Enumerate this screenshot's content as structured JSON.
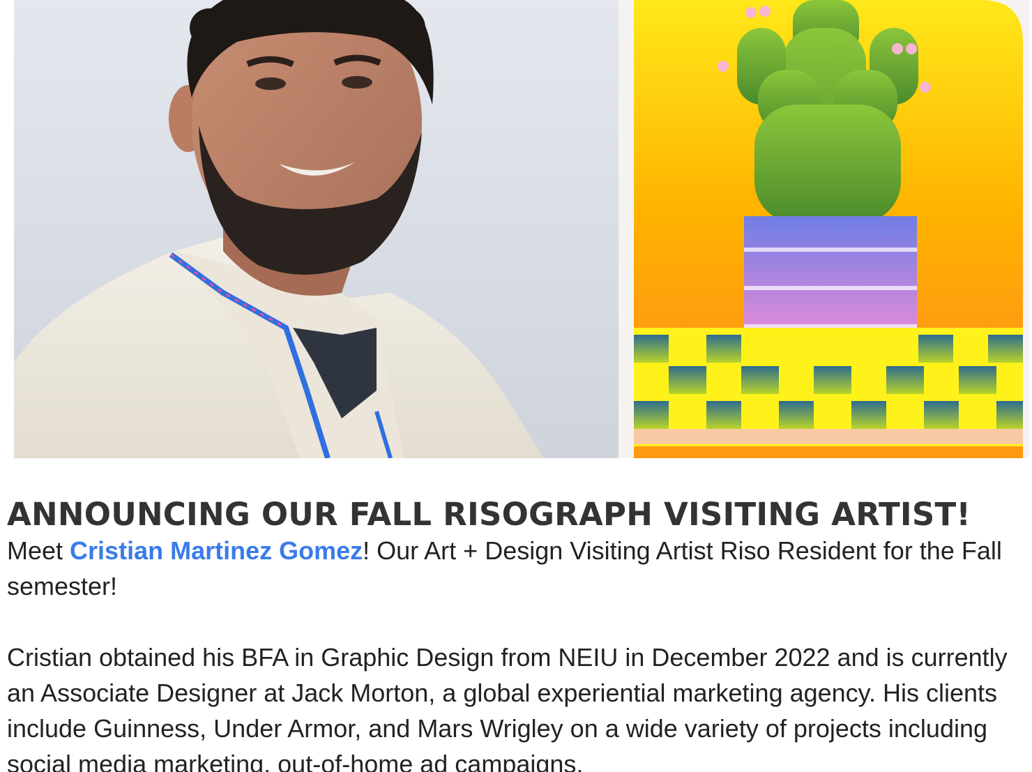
{
  "images": {
    "portrait_alt": "Portrait of Cristian Martinez Gomez",
    "poster_alt": "Risograph print of a potted cactus"
  },
  "article": {
    "headline": "ANNOUNCING OUR FALL RISOGRAPH VISITING ARTIST!",
    "intro_before": "Meet ",
    "artist_link": "Cristian Martinez Gomez",
    "intro_after": "! Our Art + Design Visiting Artist Riso Resident for the Fall semester!",
    "bio": "Cristian obtained his BFA in Graphic Design from NEIU in December 2022 and is currently an Associate Designer at Jack Morton, a global experiential marketing agency. His clients include Guinness, Under Armor, and Mars Wrigley on a wide variety of projects including social media marketing, out-of-home ad campaigns,"
  },
  "colors": {
    "link": "#3a7bea",
    "headline": "#333333",
    "body": "#222222"
  }
}
